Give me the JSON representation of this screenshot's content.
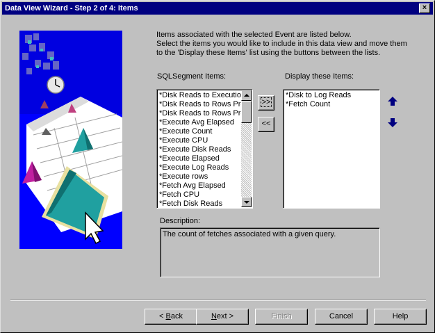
{
  "window": {
    "title": "Data View Wizard - Step 2 of 4:  Items",
    "close_label": "×"
  },
  "intro": {
    "line1": "Items associated with the selected Event are listed below.",
    "line2": "Select the items you would like to include in this data view and move them",
    "line3": "to the 'Display these Items' list using the buttons between the lists."
  },
  "available": {
    "label": "SQLSegment Items:",
    "items": [
      "*Disk Reads to Execution",
      "*Disk Reads to Rows Pro",
      "*Disk Reads to Rows Pro",
      "*Execute Avg Elapsed",
      "*Execute Count",
      "*Execute CPU",
      "*Execute Disk Reads",
      "*Execute Elapsed",
      "*Execute Log Reads",
      "*Execute rows",
      "*Fetch Avg Elapsed",
      "*Fetch CPU",
      "*Fetch Disk Reads"
    ]
  },
  "move": {
    "add_label": ">>",
    "remove_label": "<<"
  },
  "selected": {
    "label": "Display these Items:",
    "items": [
      "*Disk to Log Reads",
      "*Fetch Count"
    ]
  },
  "description": {
    "label": "Description:",
    "text": "The count of fetches associated with a given query."
  },
  "buttons": {
    "back": "< Back",
    "next": "Next >",
    "finish": "Finish",
    "cancel": "Cancel",
    "help": "Help"
  },
  "colors": {
    "title_bar": "#000080",
    "face": "#c0c0c0",
    "move_arrows": "#000080",
    "art_background": "#0000ff"
  }
}
